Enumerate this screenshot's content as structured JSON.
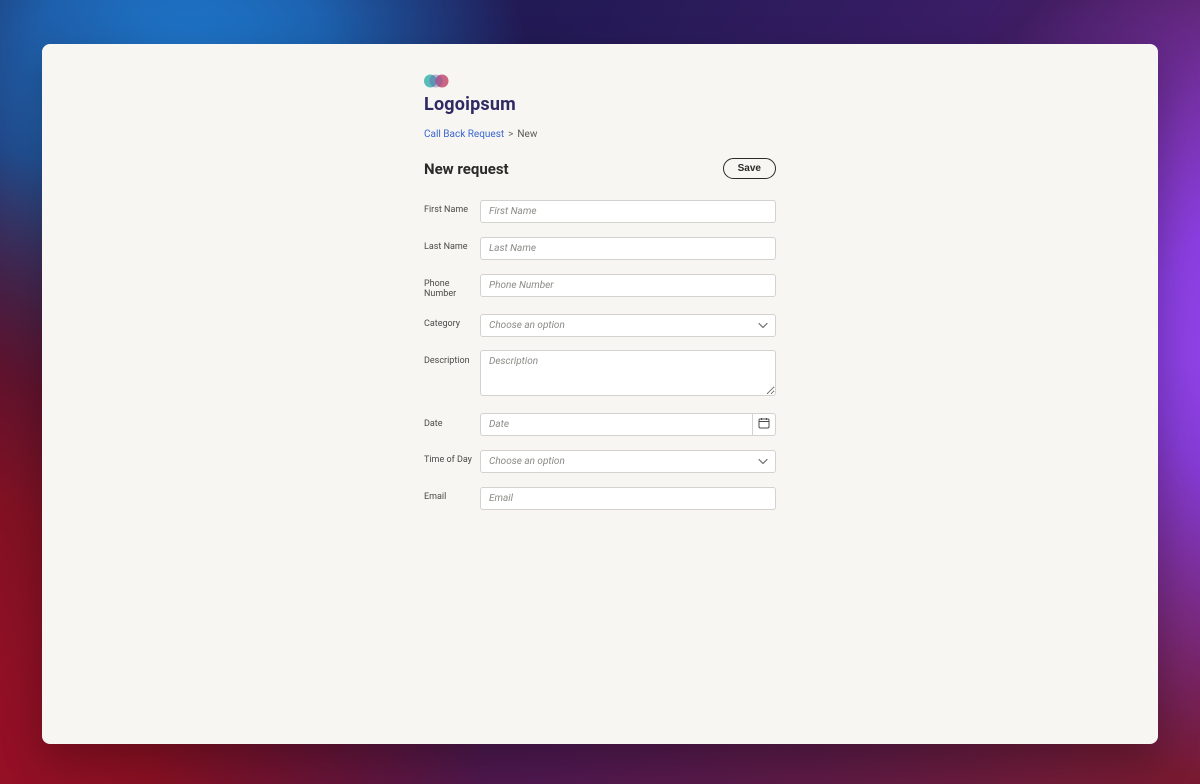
{
  "brand": {
    "name": "Logoipsum"
  },
  "breadcrumb": {
    "parent": "Call Back Request",
    "current": "New",
    "sep": ">"
  },
  "header": {
    "title": "New request",
    "save": "Save"
  },
  "form": {
    "firstName": {
      "label": "First Name",
      "placeholder": "First Name"
    },
    "lastName": {
      "label": "Last Name",
      "placeholder": "Last Name"
    },
    "phone": {
      "label": "Phone Number",
      "placeholder": "Phone Number"
    },
    "category": {
      "label": "Category",
      "placeholder": "Choose an option"
    },
    "description": {
      "label": "Description",
      "placeholder": "Description"
    },
    "date": {
      "label": "Date",
      "placeholder": "Date"
    },
    "timeOfDay": {
      "label": "Time of Day",
      "placeholder": "Choose an option"
    },
    "email": {
      "label": "Email",
      "placeholder": "Email"
    }
  }
}
